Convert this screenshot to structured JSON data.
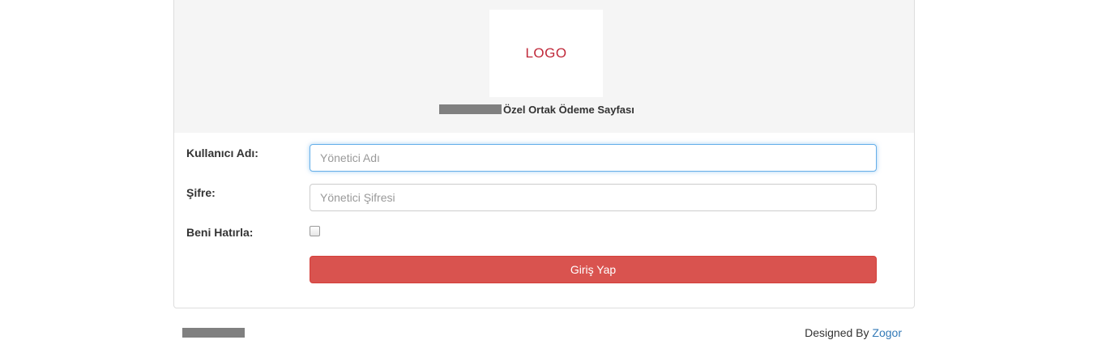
{
  "header": {
    "logo_text": "LOGO",
    "title": "Özel Ortak Ödeme Sayfası"
  },
  "form": {
    "username_label": "Kullanıcı Adı:",
    "username_placeholder": "Yönetici Adı",
    "password_label": "Şifre:",
    "password_placeholder": "Yönetici Şifresi",
    "remember_label": "Beni Hatırla:",
    "submit_label": "Giriş Yap"
  },
  "footer": {
    "designed_by": "Designed By",
    "designer_link": "Zogor"
  },
  "colors": {
    "logo_text": "#c0293a",
    "button": "#d9534f",
    "link": "#337ab7",
    "focus_border": "#66afe9"
  }
}
